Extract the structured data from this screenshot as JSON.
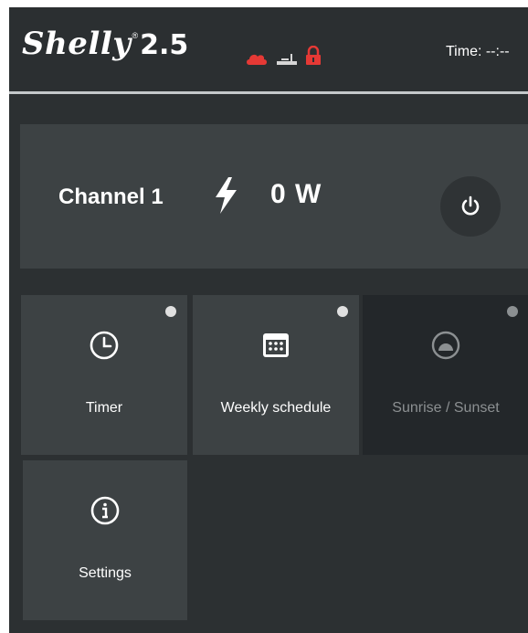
{
  "header": {
    "brand_name": "Shelly",
    "brand_reg": "®",
    "brand_model": "2.5",
    "status_icons": [
      "cloud-icon",
      "wifi-router-icon",
      "lock-icon"
    ],
    "time_text": "Time: --:--"
  },
  "channel": {
    "label": "Channel  1",
    "power": "0 W",
    "icons": [
      "bolt-icon",
      "power-icon"
    ]
  },
  "tiles": [
    {
      "label": "Timer",
      "icon": "clock-icon"
    },
    {
      "label": "Weekly schedule",
      "icon": "calendar-icon"
    },
    {
      "label": "Sunrise / Sunset",
      "icon": "sun-icon"
    },
    {
      "label": "Settings",
      "icon": "info-icon"
    }
  ],
  "colors": {
    "background": "#2c3032",
    "card": "#3d4244",
    "card_dark": "#23272a",
    "accent_red": "#e53935",
    "text": "#ffffff"
  }
}
